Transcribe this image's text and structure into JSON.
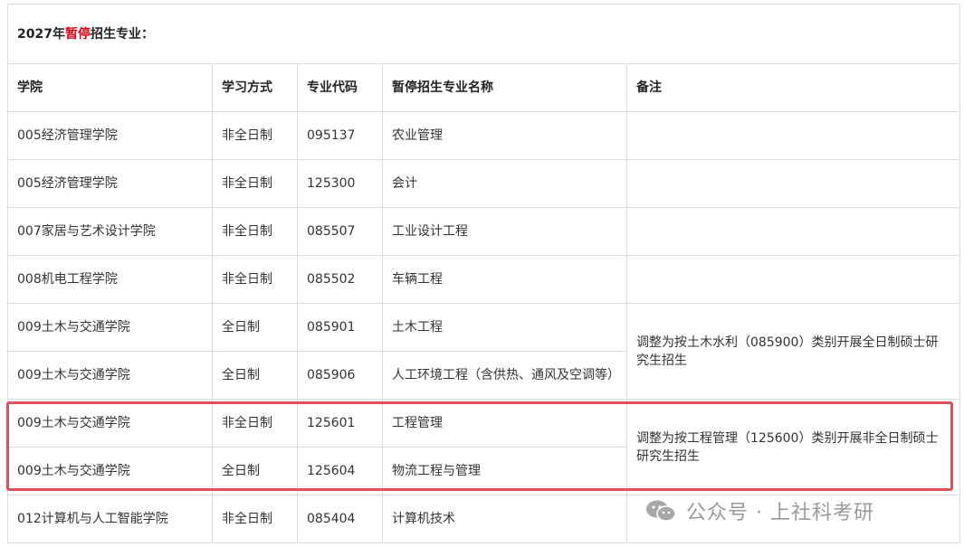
{
  "title": {
    "prefix": "2027年",
    "highlight": "暂停",
    "suffix": "招生专业："
  },
  "headers": [
    "学院",
    "学习方式",
    "专业代码",
    "暂停招生专业名称",
    "备注"
  ],
  "rows": [
    [
      "005经济管理学院",
      "非全日制",
      "095137",
      "农业管理"
    ],
    [
      "005经济管理学院",
      "非全日制",
      "125300",
      "会计"
    ],
    [
      "007家居与艺术设计学院",
      "非全日制",
      "085507",
      "工业设计工程"
    ],
    [
      "008机电工程学院",
      "非全日制",
      "085502",
      "车辆工程"
    ],
    [
      "009土木与交通学院",
      "全日制",
      "085901",
      "土木工程"
    ],
    [
      "009土木与交通学院",
      "全日制",
      "085906",
      "人工环境工程（含供热、通风及空调等）"
    ],
    [
      "009土木与交通学院",
      "非全日制",
      "125601",
      "工程管理"
    ],
    [
      "009土木与交通学院",
      "全日制",
      "125604",
      "物流工程与管理"
    ],
    [
      "012计算机与人工智能学院",
      "非全日制",
      "085404",
      "计算机技术"
    ]
  ],
  "notes": {
    "civil": "调整为按土木水利（085900）类别开展全日制硕士研究生招生",
    "engineering_mgmt": "调整为按工程管理（125600）类别开展非全日制硕士研究生招生"
  },
  "watermark": {
    "text": "公众号 · 上社科考研",
    "icon": "wechat-icon"
  },
  "colors": {
    "highlight_border": "#e0505a",
    "title_red": "#e60012"
  }
}
